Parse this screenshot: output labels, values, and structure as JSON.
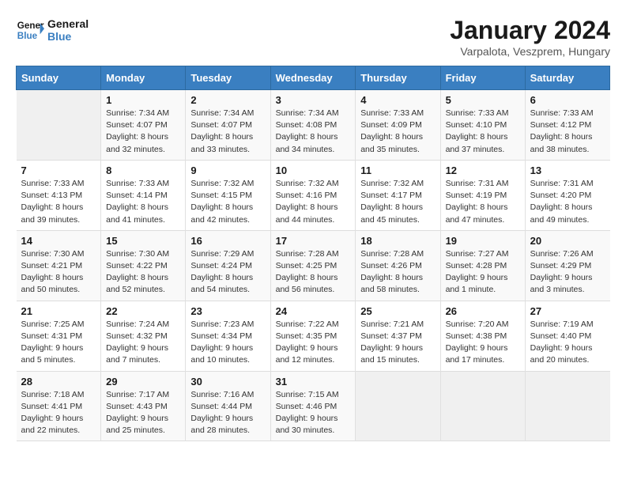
{
  "logo": {
    "line1": "General",
    "line2": "Blue"
  },
  "title": "January 2024",
  "subtitle": "Varpalota, Veszprem, Hungary",
  "days_of_week": [
    "Sunday",
    "Monday",
    "Tuesday",
    "Wednesday",
    "Thursday",
    "Friday",
    "Saturday"
  ],
  "weeks": [
    [
      {
        "day": "",
        "info": ""
      },
      {
        "day": "1",
        "info": "Sunrise: 7:34 AM\nSunset: 4:07 PM\nDaylight: 8 hours\nand 32 minutes."
      },
      {
        "day": "2",
        "info": "Sunrise: 7:34 AM\nSunset: 4:07 PM\nDaylight: 8 hours\nand 33 minutes."
      },
      {
        "day": "3",
        "info": "Sunrise: 7:34 AM\nSunset: 4:08 PM\nDaylight: 8 hours\nand 34 minutes."
      },
      {
        "day": "4",
        "info": "Sunrise: 7:33 AM\nSunset: 4:09 PM\nDaylight: 8 hours\nand 35 minutes."
      },
      {
        "day": "5",
        "info": "Sunrise: 7:33 AM\nSunset: 4:10 PM\nDaylight: 8 hours\nand 37 minutes."
      },
      {
        "day": "6",
        "info": "Sunrise: 7:33 AM\nSunset: 4:12 PM\nDaylight: 8 hours\nand 38 minutes."
      }
    ],
    [
      {
        "day": "7",
        "info": "Sunrise: 7:33 AM\nSunset: 4:13 PM\nDaylight: 8 hours\nand 39 minutes."
      },
      {
        "day": "8",
        "info": "Sunrise: 7:33 AM\nSunset: 4:14 PM\nDaylight: 8 hours\nand 41 minutes."
      },
      {
        "day": "9",
        "info": "Sunrise: 7:32 AM\nSunset: 4:15 PM\nDaylight: 8 hours\nand 42 minutes."
      },
      {
        "day": "10",
        "info": "Sunrise: 7:32 AM\nSunset: 4:16 PM\nDaylight: 8 hours\nand 44 minutes."
      },
      {
        "day": "11",
        "info": "Sunrise: 7:32 AM\nSunset: 4:17 PM\nDaylight: 8 hours\nand 45 minutes."
      },
      {
        "day": "12",
        "info": "Sunrise: 7:31 AM\nSunset: 4:19 PM\nDaylight: 8 hours\nand 47 minutes."
      },
      {
        "day": "13",
        "info": "Sunrise: 7:31 AM\nSunset: 4:20 PM\nDaylight: 8 hours\nand 49 minutes."
      }
    ],
    [
      {
        "day": "14",
        "info": "Sunrise: 7:30 AM\nSunset: 4:21 PM\nDaylight: 8 hours\nand 50 minutes."
      },
      {
        "day": "15",
        "info": "Sunrise: 7:30 AM\nSunset: 4:22 PM\nDaylight: 8 hours\nand 52 minutes."
      },
      {
        "day": "16",
        "info": "Sunrise: 7:29 AM\nSunset: 4:24 PM\nDaylight: 8 hours\nand 54 minutes."
      },
      {
        "day": "17",
        "info": "Sunrise: 7:28 AM\nSunset: 4:25 PM\nDaylight: 8 hours\nand 56 minutes."
      },
      {
        "day": "18",
        "info": "Sunrise: 7:28 AM\nSunset: 4:26 PM\nDaylight: 8 hours\nand 58 minutes."
      },
      {
        "day": "19",
        "info": "Sunrise: 7:27 AM\nSunset: 4:28 PM\nDaylight: 9 hours\nand 1 minute."
      },
      {
        "day": "20",
        "info": "Sunrise: 7:26 AM\nSunset: 4:29 PM\nDaylight: 9 hours\nand 3 minutes."
      }
    ],
    [
      {
        "day": "21",
        "info": "Sunrise: 7:25 AM\nSunset: 4:31 PM\nDaylight: 9 hours\nand 5 minutes."
      },
      {
        "day": "22",
        "info": "Sunrise: 7:24 AM\nSunset: 4:32 PM\nDaylight: 9 hours\nand 7 minutes."
      },
      {
        "day": "23",
        "info": "Sunrise: 7:23 AM\nSunset: 4:34 PM\nDaylight: 9 hours\nand 10 minutes."
      },
      {
        "day": "24",
        "info": "Sunrise: 7:22 AM\nSunset: 4:35 PM\nDaylight: 9 hours\nand 12 minutes."
      },
      {
        "day": "25",
        "info": "Sunrise: 7:21 AM\nSunset: 4:37 PM\nDaylight: 9 hours\nand 15 minutes."
      },
      {
        "day": "26",
        "info": "Sunrise: 7:20 AM\nSunset: 4:38 PM\nDaylight: 9 hours\nand 17 minutes."
      },
      {
        "day": "27",
        "info": "Sunrise: 7:19 AM\nSunset: 4:40 PM\nDaylight: 9 hours\nand 20 minutes."
      }
    ],
    [
      {
        "day": "28",
        "info": "Sunrise: 7:18 AM\nSunset: 4:41 PM\nDaylight: 9 hours\nand 22 minutes."
      },
      {
        "day": "29",
        "info": "Sunrise: 7:17 AM\nSunset: 4:43 PM\nDaylight: 9 hours\nand 25 minutes."
      },
      {
        "day": "30",
        "info": "Sunrise: 7:16 AM\nSunset: 4:44 PM\nDaylight: 9 hours\nand 28 minutes."
      },
      {
        "day": "31",
        "info": "Sunrise: 7:15 AM\nSunset: 4:46 PM\nDaylight: 9 hours\nand 30 minutes."
      },
      {
        "day": "",
        "info": ""
      },
      {
        "day": "",
        "info": ""
      },
      {
        "day": "",
        "info": ""
      }
    ]
  ]
}
